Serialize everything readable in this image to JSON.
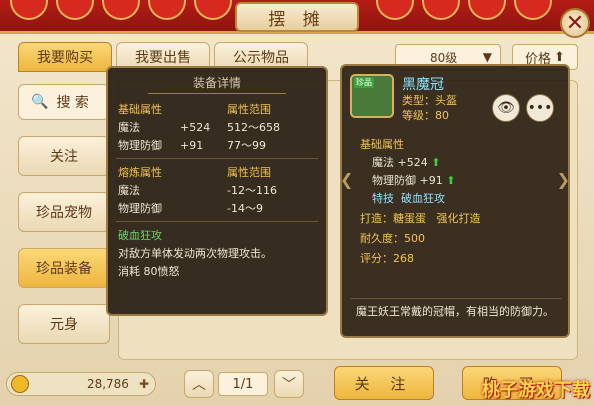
{
  "window": {
    "title": "摆 摊"
  },
  "tabs": [
    {
      "label": "我要购买",
      "active": true
    },
    {
      "label": "我要出售",
      "active": false
    },
    {
      "label": "公示物品",
      "active": false
    }
  ],
  "filters": {
    "level": "80级",
    "sort_label": "价格"
  },
  "categories": {
    "search_label": "搜 索",
    "items": [
      {
        "label": "关注",
        "active": false
      },
      {
        "label": "珍品宠物",
        "active": false
      },
      {
        "label": "珍品装备",
        "active": true
      },
      {
        "label": "元身",
        "active": false
      }
    ]
  },
  "detail": {
    "header": "装备详情",
    "base_title": "基础属性",
    "base_range_title": "属性范围",
    "base_rows": [
      {
        "name": "魔法",
        "value": "+524",
        "range": "512～658"
      },
      {
        "name": "物理防御",
        "value": "+91",
        "range": "77～99"
      }
    ],
    "refine_title": "熔炼属性",
    "refine_range_title": "属性范围",
    "refine_rows": [
      {
        "name": "魔法",
        "value": "",
        "range": "-12～116"
      },
      {
        "name": "物理防御",
        "value": "",
        "range": "-14～9"
      }
    ],
    "skill_name": "破血狂攻",
    "skill_desc": "对敌方单体发动两次物理攻击。",
    "skill_cost": "消耗 80愤怒"
  },
  "item": {
    "name": "黑魔冠",
    "type_line": "类型：头盔",
    "level_line": "等级：80",
    "badge": "珍品",
    "base_title": "基础属性",
    "stats": [
      {
        "label": "魔法 +524"
      },
      {
        "label": "物理防御 +91"
      }
    ],
    "special_label": "特技",
    "special_value": "破血狂攻",
    "forge_label": "打造：糖蛋蛋",
    "forge_extra": "强化打造",
    "durability": "耐久度：500",
    "score": "评分：268",
    "description": "魔王妖王常戴的冠帽，有相当的防御力。"
  },
  "bottom": {
    "coins": "28,786",
    "page": "1/1",
    "follow_label": "关 注",
    "buy_label": "购 买"
  },
  "watermark": "桃子游戏下载",
  "colors": {
    "gold": "#f2c34d",
    "green": "#6fd66a",
    "accent": "#eeb53f"
  }
}
